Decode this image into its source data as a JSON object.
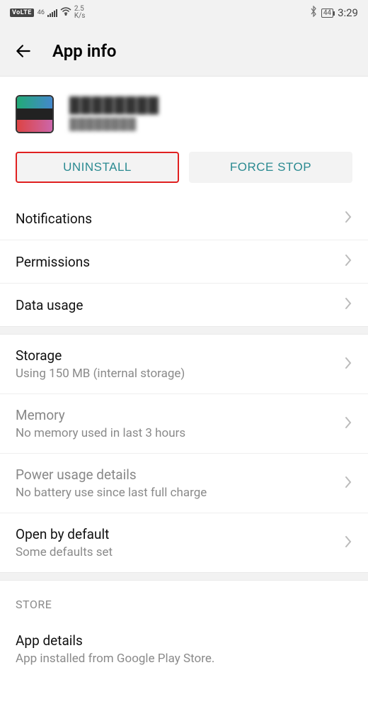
{
  "status": {
    "volte": "VoLTE",
    "net": "46",
    "ks1": "2.5",
    "ks2": "K/s",
    "battery": "44",
    "time": "3:29"
  },
  "header": {
    "title": "App info"
  },
  "app": {
    "name": "████████",
    "version": "████████"
  },
  "buttons": {
    "uninstall": "UNINSTALL",
    "forcestop": "FORCE STOP"
  },
  "rows": {
    "notifications": "Notifications",
    "permissions": "Permissions",
    "datausage": "Data usage",
    "storage_t": "Storage",
    "storage_s": "Using 150 MB (internal storage)",
    "memory_t": "Memory",
    "memory_s": "No memory used in last 3 hours",
    "power_t": "Power usage details",
    "power_s": "No battery use since last full charge",
    "openby_t": "Open by default",
    "openby_s": "Some defaults set"
  },
  "store": {
    "header": "STORE",
    "details_t": "App details",
    "details_s": "App installed from Google Play Store."
  }
}
